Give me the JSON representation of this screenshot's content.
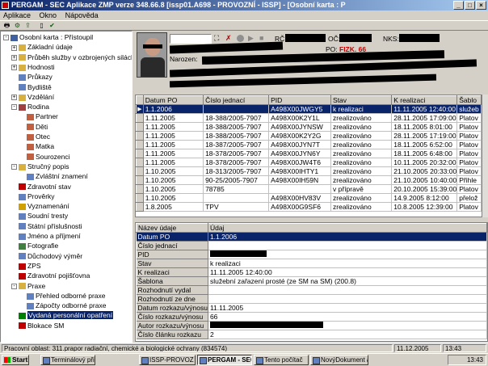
{
  "window": {
    "title": "PERGAM - SEC Aplikace ZMP verze 348.66.8 [issp01.A698 - PROVOZNÍ - ISSP] - [Osobní karta : P",
    "buttons": [
      "_",
      "□",
      "×"
    ]
  },
  "menu": [
    "Aplikace",
    "Okno",
    "Nápověda"
  ],
  "tree": {
    "items": [
      {
        "label": "Osobní karta : Přístoupil",
        "icon": "card-icon",
        "level": 0,
        "exp": "-"
      },
      {
        "label": "Základní údaje",
        "icon": "folder-icon",
        "level": 1,
        "exp": "+"
      },
      {
        "label": "Průběh služby v ozbrojených silách",
        "icon": "folder-icon",
        "level": 1,
        "exp": "+"
      },
      {
        "label": "Hodnosti",
        "icon": "folder-icon",
        "level": 1,
        "exp": "+"
      },
      {
        "label": "Průkazy",
        "icon": "doc-icon",
        "level": 1,
        "exp": ""
      },
      {
        "label": "Bydliště",
        "icon": "doc-icon",
        "level": 1,
        "exp": ""
      },
      {
        "label": "Vzdělání",
        "icon": "folder-icon",
        "level": 1,
        "exp": "+"
      },
      {
        "label": "Rodina",
        "icon": "family-icon",
        "level": 1,
        "exp": "-"
      },
      {
        "label": "Partner",
        "icon": "person-icon",
        "level": 2,
        "exp": ""
      },
      {
        "label": "Děti",
        "icon": "person-icon",
        "level": 2,
        "exp": ""
      },
      {
        "label": "Otec",
        "icon": "person-icon",
        "level": 2,
        "exp": ""
      },
      {
        "label": "Matka",
        "icon": "person-icon",
        "level": 2,
        "exp": ""
      },
      {
        "label": "Sourozenci",
        "icon": "person-icon",
        "level": 2,
        "exp": ""
      },
      {
        "label": "Stručný popis",
        "icon": "folder-icon",
        "level": 1,
        "exp": "-"
      },
      {
        "label": "Zvláštní znamení",
        "icon": "doc-icon",
        "level": 2,
        "exp": ""
      },
      {
        "label": "Zdravotní stav",
        "icon": "health-icon",
        "level": 1,
        "exp": ""
      },
      {
        "label": "Prověrky",
        "icon": "doc-icon",
        "level": 1,
        "exp": ""
      },
      {
        "label": "Vyznamenání",
        "icon": "medal-icon",
        "level": 1,
        "exp": ""
      },
      {
        "label": "Soudní tresty",
        "icon": "doc-icon",
        "level": 1,
        "exp": ""
      },
      {
        "label": "Státní příslušnosti",
        "icon": "doc-icon",
        "level": 1,
        "exp": ""
      },
      {
        "label": "Jméno a příjmení",
        "icon": "doc-icon",
        "level": 1,
        "exp": ""
      },
      {
        "label": "Fotografie",
        "icon": "photo-icon",
        "level": 1,
        "exp": ""
      },
      {
        "label": "Důchodový výměr",
        "icon": "doc-icon",
        "level": 1,
        "exp": ""
      },
      {
        "label": "ZPS",
        "icon": "health-icon",
        "level": 1,
        "exp": ""
      },
      {
        "label": "Zdravotní pojišťovna",
        "icon": "health-icon",
        "level": 1,
        "exp": ""
      },
      {
        "label": "Praxe",
        "icon": "folder-icon",
        "level": 1,
        "exp": "-"
      },
      {
        "label": "Přehled odborné praxe",
        "icon": "doc-icon",
        "level": 2,
        "exp": ""
      },
      {
        "label": "Zápočty odborné praxe",
        "icon": "doc-icon",
        "level": 2,
        "exp": ""
      },
      {
        "label": "Vydaná personální opatření",
        "icon": "check-icon",
        "level": 1,
        "exp": "",
        "selected": true
      },
      {
        "label": "Blokace SM",
        "icon": "block-icon",
        "level": 1,
        "exp": ""
      }
    ]
  },
  "header": {
    "rc_label": "RČ:",
    "oc_label": "OČ:",
    "nks_label": "NKS:",
    "po_label": "PO:",
    "po_value": "FIZK. 66",
    "narozen_label": "Narozen:"
  },
  "grid": {
    "columns": [
      "Datum PO",
      "Číslo jednací",
      "PID",
      "Stav",
      "K realizaci",
      "Šablo"
    ],
    "rows": [
      [
        "1.1.2006",
        "",
        "A498X00JWGY5",
        "k realizaci",
        "11.11.2005 12:40:00",
        "služeb"
      ],
      [
        "1.11.2005",
        "18-388/2005-7907",
        "A498X00K2Y1L",
        "zrealizováno",
        "28.11.2005 17:09:00",
        "Platov"
      ],
      [
        "1.11.2005",
        "18-388/2005-7907",
        "A498X00JYNSW",
        "zrealizováno",
        "18.11.2005 8:01:00",
        "Platov"
      ],
      [
        "1.11.2005",
        "18-388/2005-7907",
        "A498X00K2Y2G",
        "zrealizováno",
        "28.11.2005 17:19:00",
        "Platov"
      ],
      [
        "1.11.2005",
        "18-387/2005-7907",
        "A498X00JYN7T",
        "zrealizováno",
        "18.11.2005 6:52:00",
        "Platov"
      ],
      [
        "1.11.2005",
        "18-378/2005-7907",
        "A498X00JYN6Y",
        "zrealizováno",
        "18.11.2005 6:48:00",
        "Platov"
      ],
      [
        "1.11.2005",
        "18-378/2005-7907",
        "A498X00JW4T6",
        "zrealizováno",
        "10.11.2005 20:32:00",
        "Platov"
      ],
      [
        "1.10.2005",
        "18-313/2005-7907",
        "A498X00IHTY1",
        "zrealizováno",
        "21.10.2005 20:33:00",
        "Platov"
      ],
      [
        "1.10.2005",
        "90-25/2005-7907",
        "A498X00IH59N",
        "zrealizováno",
        "21.10.2005 10:40:00",
        "Přihle"
      ],
      [
        "1.10.2005",
        "78785",
        "",
        "v přípravě",
        "20.10.2005 15:39:00",
        "Platov"
      ],
      [
        "1.10.2005",
        "",
        "A498X00HV83V",
        "zrealizováno",
        "14.9.2005 8:12:00",
        "přelož"
      ],
      [
        "1.8.2005",
        "TPV",
        "A498X00G9SF6",
        "zrealizováno",
        "10.8.2005 12:39:00",
        "Platov"
      ]
    ]
  },
  "detail": {
    "columns": [
      "Název údaje",
      "Údaj"
    ],
    "rows": [
      [
        "Datum PO",
        "1.1.2006"
      ],
      [
        "Číslo jednací",
        ""
      ],
      [
        "PID",
        ""
      ],
      [
        "Stav",
        "k realizaci"
      ],
      [
        "K realizaci",
        "11.11.2005 12:40:00"
      ],
      [
        "Šablona",
        "služební zařazení prosté (ze SM na SM) (200.8)"
      ],
      [
        "Rozhodnutí vydal",
        ""
      ],
      [
        "Rozhodnutí ze dne",
        ""
      ],
      [
        "Datum rozkazu/výnosu",
        "11.11.2005"
      ],
      [
        "Číslo rozkazu/výnosu",
        "66"
      ],
      [
        "Autor rozkazu/výnosu",
        ""
      ],
      [
        "Číslo článku rozkazu",
        "2"
      ]
    ]
  },
  "status": {
    "text": "Pracovní oblast: 311.prapor radiační, chemické a biologické ochrany (834574)",
    "date": "11.12.2005",
    "time": "13:43"
  },
  "taskbar": {
    "start": "Start",
    "tasks": [
      "Terminálový přist...",
      "ISSP-PROVOZ DB...",
      "PERGAM - SEC ...",
      "Tento počítač",
      "NovýDokument a..."
    ],
    "clock": "13:43"
  },
  "colors": {
    "selection": "#0a246a",
    "po_value": "#c00000",
    "title_start": "#0a246a"
  }
}
